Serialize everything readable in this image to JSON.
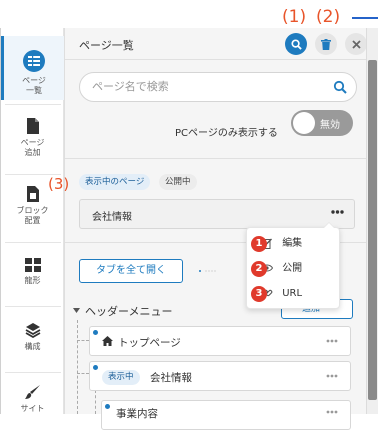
{
  "annotations": {
    "top": [
      "(1)",
      "(2)"
    ],
    "left": "(3)",
    "menu_numbers": [
      "1",
      "2",
      "3"
    ]
  },
  "sidebar": {
    "items": [
      {
        "label": "ページ\n一覧",
        "icon": "page-list-icon"
      },
      {
        "label": "ページ\n追加",
        "icon": "page-add-icon"
      },
      {
        "label": "ブロック\n配置",
        "icon": "block-place-icon"
      },
      {
        "label": "龍形",
        "icon": "layout-icon"
      },
      {
        "label": "構成",
        "icon": "layers-icon"
      },
      {
        "label": "サイト",
        "icon": "brush-icon"
      }
    ]
  },
  "panel": {
    "title": "ページ一覧",
    "search_placeholder": "ページ名で検索",
    "pc_only_label": "PCページのみ表示する",
    "toggle_label": "無効",
    "filter_chips": [
      "表示中のページ",
      "公開中"
    ],
    "selected_page": "会社情報",
    "expand_button": "タブを全て開く",
    "header_menu_label": "ヘッダーメニュー",
    "header_menu_add": "追加",
    "tree": [
      {
        "label": "トップページ",
        "icon": "home-icon"
      },
      {
        "label": "会社情報",
        "chip": "表示中"
      },
      {
        "label": "事業内容"
      }
    ]
  },
  "menu": {
    "items": [
      {
        "label": "編集",
        "icon": "edit-icon"
      },
      {
        "label": "公開",
        "icon": "eye-icon"
      },
      {
        "label": "URL",
        "icon": "link-icon"
      }
    ]
  },
  "colors": {
    "accent": "#1e7bbf",
    "annotation": "#e8542a",
    "badge": "#e03a2c"
  }
}
